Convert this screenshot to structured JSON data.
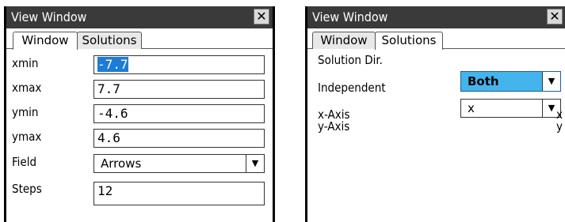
{
  "left": {
    "title": "View Window",
    "close": "✕",
    "tabs": {
      "window": "Window",
      "solutions": "Solutions"
    },
    "rows": {
      "xmin": {
        "label": "xmin",
        "value": "-7.7"
      },
      "xmax": {
        "label": "xmax",
        "value": "7.7"
      },
      "ymin": {
        "label": "ymin",
        "value": "-4.6"
      },
      "ymax": {
        "label": "ymax",
        "value": "4.6"
      },
      "field": {
        "label": "Field",
        "value": "Arrows"
      },
      "steps": {
        "label": "Steps",
        "value": "12"
      }
    },
    "arrow": "▼"
  },
  "right": {
    "title": "View Window",
    "close": "✕",
    "tabs": {
      "window": "Window",
      "solutions": "Solutions"
    },
    "solution_dir": {
      "label": "Solution Dir.",
      "value": "Both"
    },
    "independent": {
      "label": "Independent",
      "value": "x"
    },
    "x_axis": {
      "label": "x-Axis",
      "value": "x"
    },
    "y_axis": {
      "label": "y-Axis",
      "value": "y"
    },
    "arrow": "▼"
  },
  "colors": {
    "titlebar": "#3a3a3a",
    "selection": "#1e7bd6",
    "highlight": "#44b4ec"
  }
}
